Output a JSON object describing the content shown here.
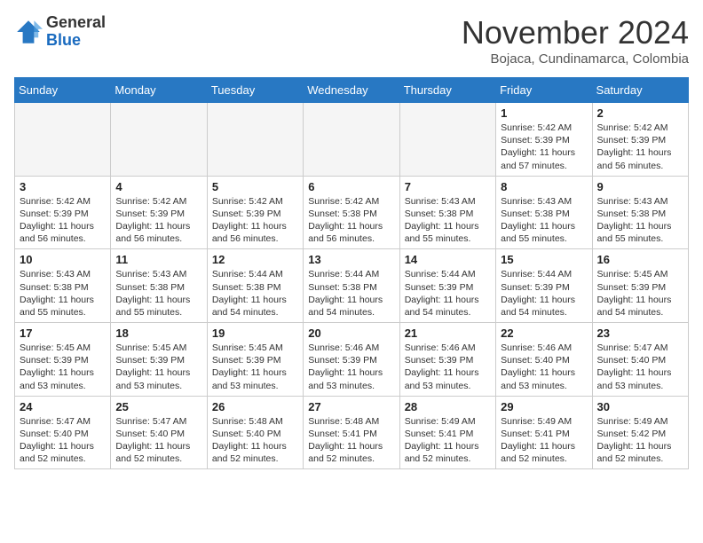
{
  "header": {
    "logo_general": "General",
    "logo_blue": "Blue",
    "month_title": "November 2024",
    "location": "Bojaca, Cundinamarca, Colombia"
  },
  "weekdays": [
    "Sunday",
    "Monday",
    "Tuesday",
    "Wednesday",
    "Thursday",
    "Friday",
    "Saturday"
  ],
  "weeks": [
    [
      {
        "day": "",
        "info": ""
      },
      {
        "day": "",
        "info": ""
      },
      {
        "day": "",
        "info": ""
      },
      {
        "day": "",
        "info": ""
      },
      {
        "day": "",
        "info": ""
      },
      {
        "day": "1",
        "info": "Sunrise: 5:42 AM\nSunset: 5:39 PM\nDaylight: 11 hours\nand 57 minutes."
      },
      {
        "day": "2",
        "info": "Sunrise: 5:42 AM\nSunset: 5:39 PM\nDaylight: 11 hours\nand 56 minutes."
      }
    ],
    [
      {
        "day": "3",
        "info": "Sunrise: 5:42 AM\nSunset: 5:39 PM\nDaylight: 11 hours\nand 56 minutes."
      },
      {
        "day": "4",
        "info": "Sunrise: 5:42 AM\nSunset: 5:39 PM\nDaylight: 11 hours\nand 56 minutes."
      },
      {
        "day": "5",
        "info": "Sunrise: 5:42 AM\nSunset: 5:39 PM\nDaylight: 11 hours\nand 56 minutes."
      },
      {
        "day": "6",
        "info": "Sunrise: 5:42 AM\nSunset: 5:38 PM\nDaylight: 11 hours\nand 56 minutes."
      },
      {
        "day": "7",
        "info": "Sunrise: 5:43 AM\nSunset: 5:38 PM\nDaylight: 11 hours\nand 55 minutes."
      },
      {
        "day": "8",
        "info": "Sunrise: 5:43 AM\nSunset: 5:38 PM\nDaylight: 11 hours\nand 55 minutes."
      },
      {
        "day": "9",
        "info": "Sunrise: 5:43 AM\nSunset: 5:38 PM\nDaylight: 11 hours\nand 55 minutes."
      }
    ],
    [
      {
        "day": "10",
        "info": "Sunrise: 5:43 AM\nSunset: 5:38 PM\nDaylight: 11 hours\nand 55 minutes."
      },
      {
        "day": "11",
        "info": "Sunrise: 5:43 AM\nSunset: 5:38 PM\nDaylight: 11 hours\nand 55 minutes."
      },
      {
        "day": "12",
        "info": "Sunrise: 5:44 AM\nSunset: 5:38 PM\nDaylight: 11 hours\nand 54 minutes."
      },
      {
        "day": "13",
        "info": "Sunrise: 5:44 AM\nSunset: 5:38 PM\nDaylight: 11 hours\nand 54 minutes."
      },
      {
        "day": "14",
        "info": "Sunrise: 5:44 AM\nSunset: 5:39 PM\nDaylight: 11 hours\nand 54 minutes."
      },
      {
        "day": "15",
        "info": "Sunrise: 5:44 AM\nSunset: 5:39 PM\nDaylight: 11 hours\nand 54 minutes."
      },
      {
        "day": "16",
        "info": "Sunrise: 5:45 AM\nSunset: 5:39 PM\nDaylight: 11 hours\nand 54 minutes."
      }
    ],
    [
      {
        "day": "17",
        "info": "Sunrise: 5:45 AM\nSunset: 5:39 PM\nDaylight: 11 hours\nand 53 minutes."
      },
      {
        "day": "18",
        "info": "Sunrise: 5:45 AM\nSunset: 5:39 PM\nDaylight: 11 hours\nand 53 minutes."
      },
      {
        "day": "19",
        "info": "Sunrise: 5:45 AM\nSunset: 5:39 PM\nDaylight: 11 hours\nand 53 minutes."
      },
      {
        "day": "20",
        "info": "Sunrise: 5:46 AM\nSunset: 5:39 PM\nDaylight: 11 hours\nand 53 minutes."
      },
      {
        "day": "21",
        "info": "Sunrise: 5:46 AM\nSunset: 5:39 PM\nDaylight: 11 hours\nand 53 minutes."
      },
      {
        "day": "22",
        "info": "Sunrise: 5:46 AM\nSunset: 5:40 PM\nDaylight: 11 hours\nand 53 minutes."
      },
      {
        "day": "23",
        "info": "Sunrise: 5:47 AM\nSunset: 5:40 PM\nDaylight: 11 hours\nand 53 minutes."
      }
    ],
    [
      {
        "day": "24",
        "info": "Sunrise: 5:47 AM\nSunset: 5:40 PM\nDaylight: 11 hours\nand 52 minutes."
      },
      {
        "day": "25",
        "info": "Sunrise: 5:47 AM\nSunset: 5:40 PM\nDaylight: 11 hours\nand 52 minutes."
      },
      {
        "day": "26",
        "info": "Sunrise: 5:48 AM\nSunset: 5:40 PM\nDaylight: 11 hours\nand 52 minutes."
      },
      {
        "day": "27",
        "info": "Sunrise: 5:48 AM\nSunset: 5:41 PM\nDaylight: 11 hours\nand 52 minutes."
      },
      {
        "day": "28",
        "info": "Sunrise: 5:49 AM\nSunset: 5:41 PM\nDaylight: 11 hours\nand 52 minutes."
      },
      {
        "day": "29",
        "info": "Sunrise: 5:49 AM\nSunset: 5:41 PM\nDaylight: 11 hours\nand 52 minutes."
      },
      {
        "day": "30",
        "info": "Sunrise: 5:49 AM\nSunset: 5:42 PM\nDaylight: 11 hours\nand 52 minutes."
      }
    ]
  ]
}
